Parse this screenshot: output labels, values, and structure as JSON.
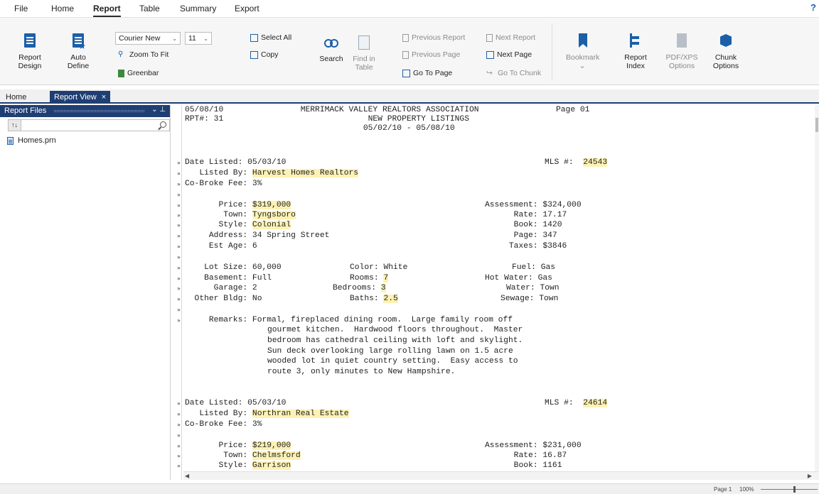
{
  "menu": {
    "items": [
      "File",
      "Home",
      "Report",
      "Table",
      "Summary",
      "Export"
    ],
    "help": "?"
  },
  "ribbon": {
    "report_design": "Report Design",
    "auto_define": "Auto Define",
    "font_name": "Courier New",
    "font_size": "11",
    "zoom_to_fit": "Zoom To Fit",
    "greenbar": "Greenbar",
    "select_all": "Select All",
    "copy": "Copy",
    "search": "Search",
    "find_in_table": "Find in Table",
    "previous_report": "Previous Report",
    "next_report": "Next Report",
    "previous_page": "Previous Page",
    "next_page": "Next Page",
    "go_to_page": "Go To Page",
    "go_to_chunk": "Go To Chunk",
    "bookmark": "Bookmark",
    "report_index": "Report Index",
    "pdf_xps_options": "PDF/XPS Options",
    "chunk_options": "Chunk Options"
  },
  "tabs": {
    "home": "Home",
    "report_view": "Report View",
    "close": "×"
  },
  "side_panel": {
    "title": "Report Files",
    "sort_label": "↑↓",
    "files": [
      "Homes.prn"
    ]
  },
  "accent_color": "#1f3e73",
  "highlight_color": "#fdf2b4",
  "report": {
    "header": [
      "05/08/10                MERRIMACK VALLEY REALTORS ASSOCIATION                Page 01",
      "RPT#: 31                              NEW PROPERTY LISTINGS",
      "                                     05/02/10 - 05/08/10"
    ],
    "listing1": {
      "date_listed": "05/03/10",
      "mls": "24543",
      "listed_by": "Harvest Homes Realtors",
      "co_broke_fee": "3%",
      "price": "$319,000",
      "assessment": "$324,000",
      "town": "Tyngsboro",
      "rate": "17.17",
      "style": "Colonial",
      "book": "1420",
      "address": "34 Spring Street",
      "page": "347",
      "est_age": "6",
      "taxes": "$3846",
      "lot_size": "60,000",
      "color": "White",
      "fuel": "Gas",
      "basement": "Full",
      "rooms": "7",
      "hot_water": "Gas",
      "garage": "2",
      "bedrooms": "3",
      "water": "Town",
      "other_bldg": "No",
      "baths": "2.5",
      "sewage": "Town",
      "remarks": [
        "Formal, fireplaced dining room.  Large family room off",
        "gourmet kitchen.  Hardwood floors throughout.  Master",
        "bedroom has cathedral ceiling with loft and skylight.",
        "Sun deck overlooking large rolling lawn on 1.5 acre",
        "wooded lot in quiet country setting.  Easy access to",
        "route 3, only minutes to New Hampshire."
      ]
    },
    "listing2": {
      "date_listed": "05/03/10",
      "mls": "24614",
      "listed_by": "Northran Real Estate",
      "co_broke_fee": "3%",
      "price": "$219,000",
      "assessment": "$231,000",
      "town": "Chelmsford",
      "rate": "16.87",
      "style": "Garrison",
      "book": "1161"
    }
  },
  "status": {
    "page": "Page 1",
    "zoom": "100%"
  }
}
